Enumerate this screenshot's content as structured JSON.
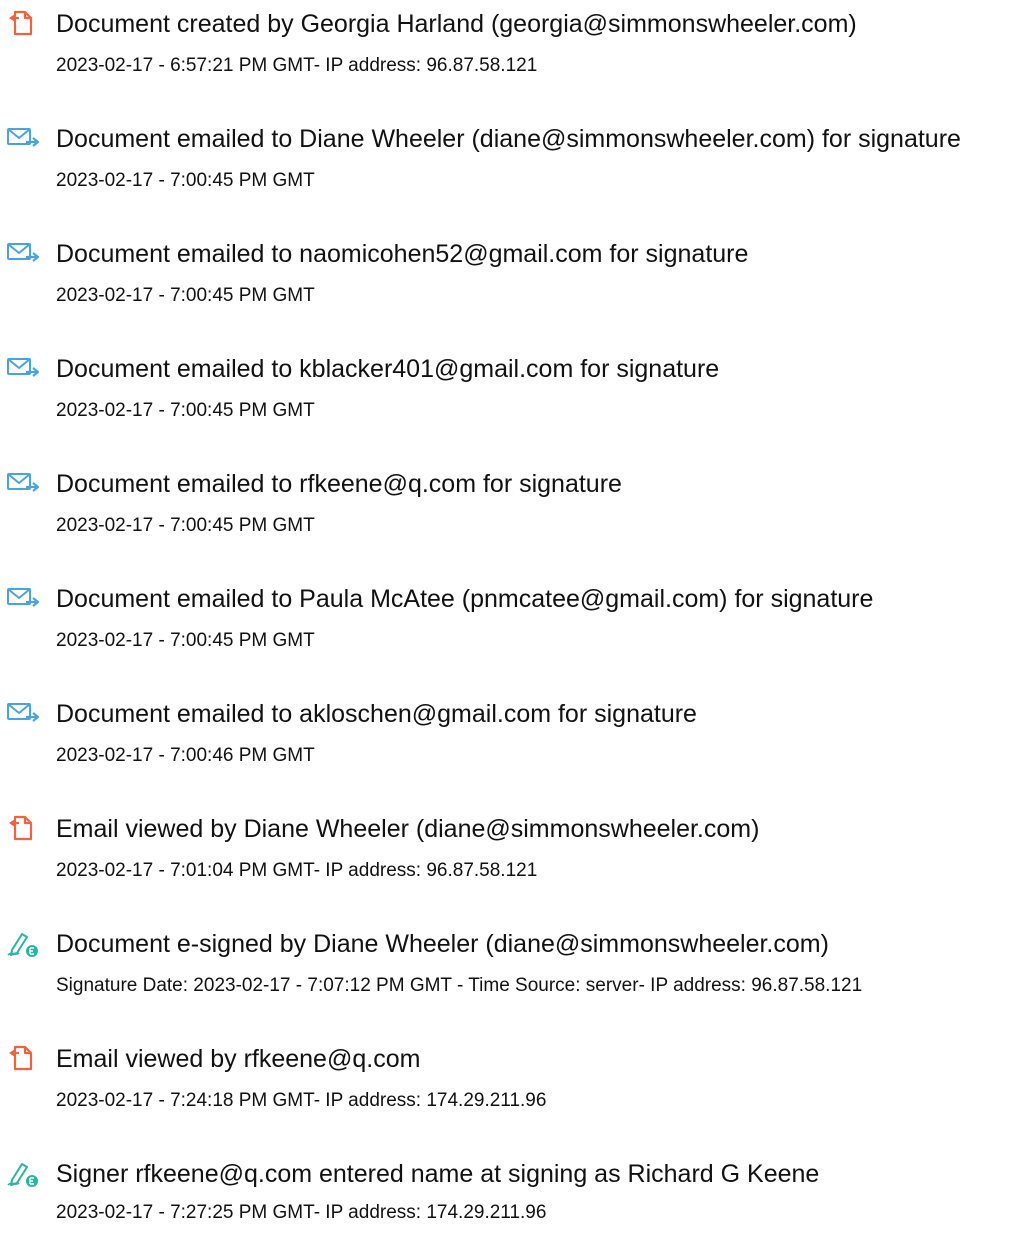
{
  "events": [
    {
      "icon": "document-icon",
      "title": "Document created by Georgia Harland (georgia@simmonswheeler.com)",
      "detail": "2023-02-17 - 6:57:21 PM GMT- IP address: 96.87.58.121"
    },
    {
      "icon": "email-sent-icon",
      "title": "Document emailed to Diane Wheeler (diane@simmonswheeler.com) for signature",
      "detail": "2023-02-17 - 7:00:45 PM GMT"
    },
    {
      "icon": "email-sent-icon",
      "title": "Document emailed to naomicohen52@gmail.com for signature",
      "detail": "2023-02-17 - 7:00:45 PM GMT"
    },
    {
      "icon": "email-sent-icon",
      "title": "Document emailed to kblacker401@gmail.com for signature",
      "detail": "2023-02-17 - 7:00:45 PM GMT"
    },
    {
      "icon": "email-sent-icon",
      "title": "Document emailed to rfkeene@q.com for signature",
      "detail": "2023-02-17 - 7:00:45 PM GMT"
    },
    {
      "icon": "email-sent-icon",
      "title": "Document emailed to Paula McAtee (pnmcatee@gmail.com) for signature",
      "detail": "2023-02-17 - 7:00:45 PM GMT"
    },
    {
      "icon": "email-sent-icon",
      "title": "Document emailed to akloschen@gmail.com for signature",
      "detail": "2023-02-17 - 7:00:46 PM GMT"
    },
    {
      "icon": "document-icon",
      "title": "Email viewed by Diane Wheeler (diane@simmonswheeler.com)",
      "detail": "2023-02-17 - 7:01:04 PM GMT- IP address: 96.87.58.121"
    },
    {
      "icon": "esign-pen-icon",
      "title": "Document e-signed by Diane Wheeler (diane@simmonswheeler.com)",
      "detail": "Signature Date: 2023-02-17 - 7:07:12 PM GMT - Time Source: server- IP address: 96.87.58.121"
    },
    {
      "icon": "document-icon",
      "title": "Email viewed by rfkeene@q.com",
      "detail": "2023-02-17 - 7:24:18 PM GMT- IP address: 174.29.211.96"
    },
    {
      "icon": "esign-pen-icon",
      "title": "Signer rfkeene@q.com entered name at signing as Richard G Keene",
      "detail": "2023-02-17 - 7:27:25 PM GMT- IP address: 174.29.211.96"
    }
  ],
  "colors": {
    "document_icon": "#f0633e",
    "email_icon": "#4aa3df",
    "esign_icon": "#2bb5a0"
  }
}
